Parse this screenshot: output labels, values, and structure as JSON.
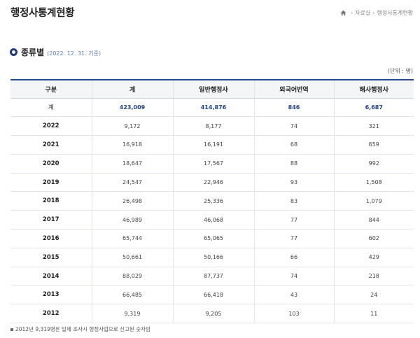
{
  "header": {
    "title": "행정사통계현황",
    "breadcrumb": [
      "자료실",
      "행정사통계현황"
    ]
  },
  "section": {
    "title": "종류별",
    "date": "(2022. 12. 31. 기준)"
  },
  "unit": "(단위 : 명)",
  "table": {
    "headers": [
      "구분",
      "계",
      "일반행정사",
      "외국어번역",
      "해사행정사"
    ],
    "rows": [
      [
        "계",
        "423,009",
        "414,876",
        "846",
        "6,687"
      ],
      [
        "2022",
        "9,172",
        "8,177",
        "74",
        "321"
      ],
      [
        "2021",
        "16,918",
        "16,191",
        "68",
        "659"
      ],
      [
        "2020",
        "18,647",
        "17,567",
        "88",
        "992"
      ],
      [
        "2019",
        "24,547",
        "22,946",
        "93",
        "1,508"
      ],
      [
        "2018",
        "26,498",
        "25,336",
        "83",
        "1,079"
      ],
      [
        "2017",
        "46,989",
        "46,068",
        "77",
        "844"
      ],
      [
        "2016",
        "65,744",
        "65,065",
        "77",
        "602"
      ],
      [
        "2015",
        "50,661",
        "50,166",
        "66",
        "429"
      ],
      [
        "2014",
        "88,029",
        "87,737",
        "74",
        "218"
      ],
      [
        "2013",
        "66,485",
        "66,418",
        "43",
        "24"
      ],
      [
        "2012",
        "9,319",
        "9,205",
        "103",
        "11"
      ]
    ]
  },
  "footnote": "2012년 9,319명은 일제 조사시 행정사업으로 신고된 숫자임",
  "colors": {
    "accent": "#2b4a8c",
    "total_text": "#1e3f8a",
    "date_text": "#5b7ec4"
  }
}
